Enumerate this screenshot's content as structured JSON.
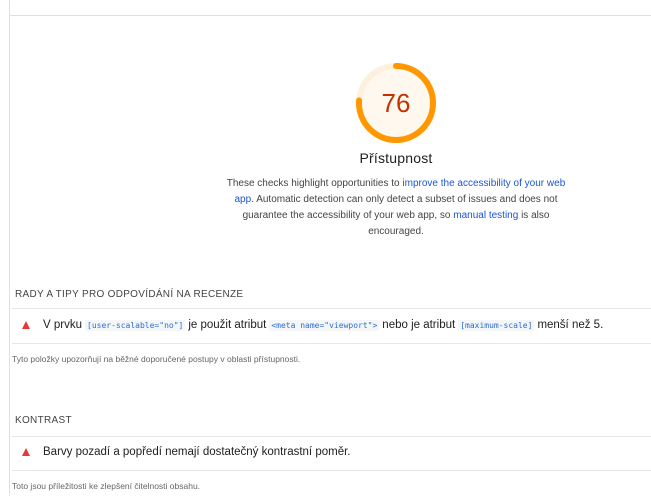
{
  "category": {
    "score": "76",
    "score_fraction": 0.76,
    "score_color": "#ff9800",
    "title": "Přístupnost",
    "description": {
      "part1": "These checks highlight opportunities to ",
      "link1": "improve the accessibility of your web app",
      "part2": ". Automatic detection can only detect a subset of issues and does not guarantee the accessibility of your web app, so ",
      "link2": "manual testing",
      "part3": " is also encouraged."
    }
  },
  "groups": [
    {
      "heading": "RADY A TIPY PRO ODPOVÍDÁNÍ NA RECENZE",
      "audit": {
        "text1": "V prvku",
        "code1": "[user-scalable=\"no\"]",
        "text2": "je použit atribut",
        "code2": "<meta name=\"viewport\">",
        "text3": "nebo je atribut",
        "code3": "[maximum-scale]",
        "text4": "menší než 5."
      },
      "note": "Tyto položky upozorňují na běžné doporučené postupy v oblasti přístupnosti."
    },
    {
      "heading": "KONTRAST",
      "audit": {
        "text1": "Barvy pozadí a popředí nemají dostatečný kontrastní poměr."
      },
      "note": "Toto jsou příležitosti ke zlepšení čitelnosti obsahu."
    }
  ],
  "colors": {
    "fail_icon": "#e53935",
    "link": "#1a55d6",
    "score_text": "#c33300"
  },
  "icons": {
    "fail": "warning-triangle-icon"
  }
}
